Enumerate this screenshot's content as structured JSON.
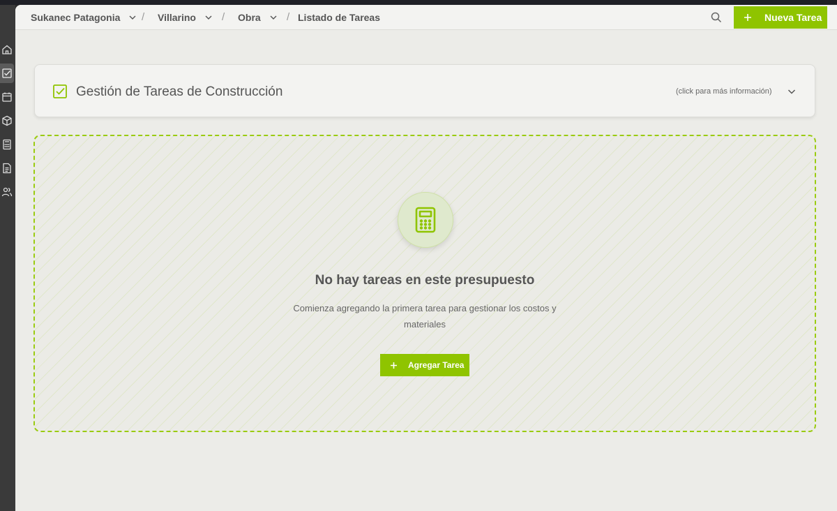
{
  "breadcrumb": {
    "items": [
      {
        "label": "Sukanec Patagonia",
        "has_dropdown": true
      },
      {
        "label": "Villarino",
        "has_dropdown": true
      },
      {
        "label": "Obra",
        "has_dropdown": true
      },
      {
        "label": "Listado de Tareas",
        "has_dropdown": false
      }
    ],
    "separator": "/"
  },
  "topbar": {
    "search_icon": "search-icon",
    "new_button_label": "Nueva Tarea",
    "accent_color": "#8fc400"
  },
  "sidebar": {
    "items": [
      {
        "icon": "home-icon",
        "active": false
      },
      {
        "icon": "checkbox-icon",
        "active": true
      },
      {
        "icon": "calendar-icon",
        "active": false
      },
      {
        "icon": "box-icon",
        "active": false
      },
      {
        "icon": "calculator-icon",
        "active": false
      },
      {
        "icon": "document-icon",
        "active": false
      },
      {
        "icon": "users-icon",
        "active": false
      }
    ]
  },
  "info_card": {
    "icon": "checkbox-icon",
    "title": "Gestión de Tareas de Construcción",
    "hint": "(click para más información)"
  },
  "empty_state": {
    "icon": "calculator-icon",
    "title": "No hay tareas en este presupuesto",
    "description": "Comienza agregando la primera tarea para gestionar los costos y materiales",
    "button_label": "Agregar Tarea"
  }
}
